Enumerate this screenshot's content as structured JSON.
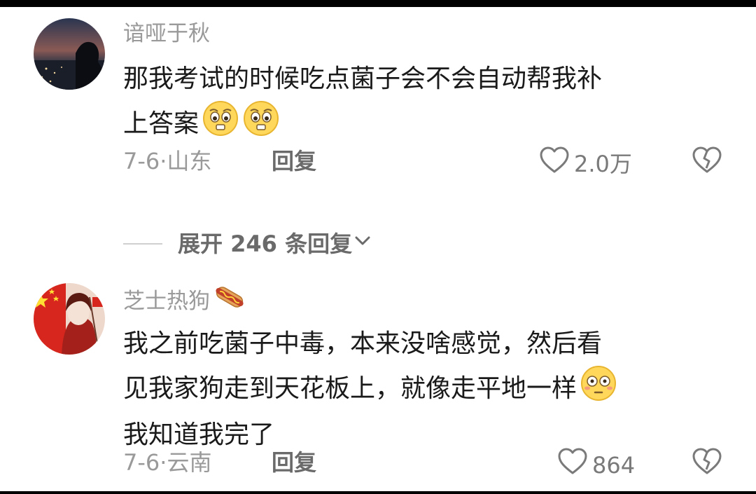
{
  "comments": [
    {
      "username": "谙哑于秋",
      "content_lines": [
        "那我考试的时候吃点菌子会不会自动帮我补",
        "上答案"
      ],
      "emoji": [
        "pleading-face-emoji",
        "pleading-face-emoji"
      ],
      "date": "7-6",
      "location": "山东",
      "reply_label": "回复",
      "likes": "2.0万"
    },
    {
      "username": "芝士热狗",
      "username_emoji": "hotdog-emoji",
      "content_lines": [
        "我之前吃菌子中毒，本来没啥感觉，然后看",
        "见我家狗走到天花板上，就像走平地一样",
        "我知道我完了"
      ],
      "emoji": [
        "flushed-face-emoji"
      ],
      "date": "7-6",
      "location": "云南",
      "reply_label": "回复",
      "likes": "864"
    }
  ],
  "expand_replies": {
    "label": "展开 246 条回复"
  },
  "colors": {
    "text_primary": "#1a1a1a",
    "text_secondary": "#9a9a9a",
    "avatar1_bg": "#1b2333",
    "avatar2_bg": "#e8d6cc",
    "flag_red": "#d7261d"
  }
}
